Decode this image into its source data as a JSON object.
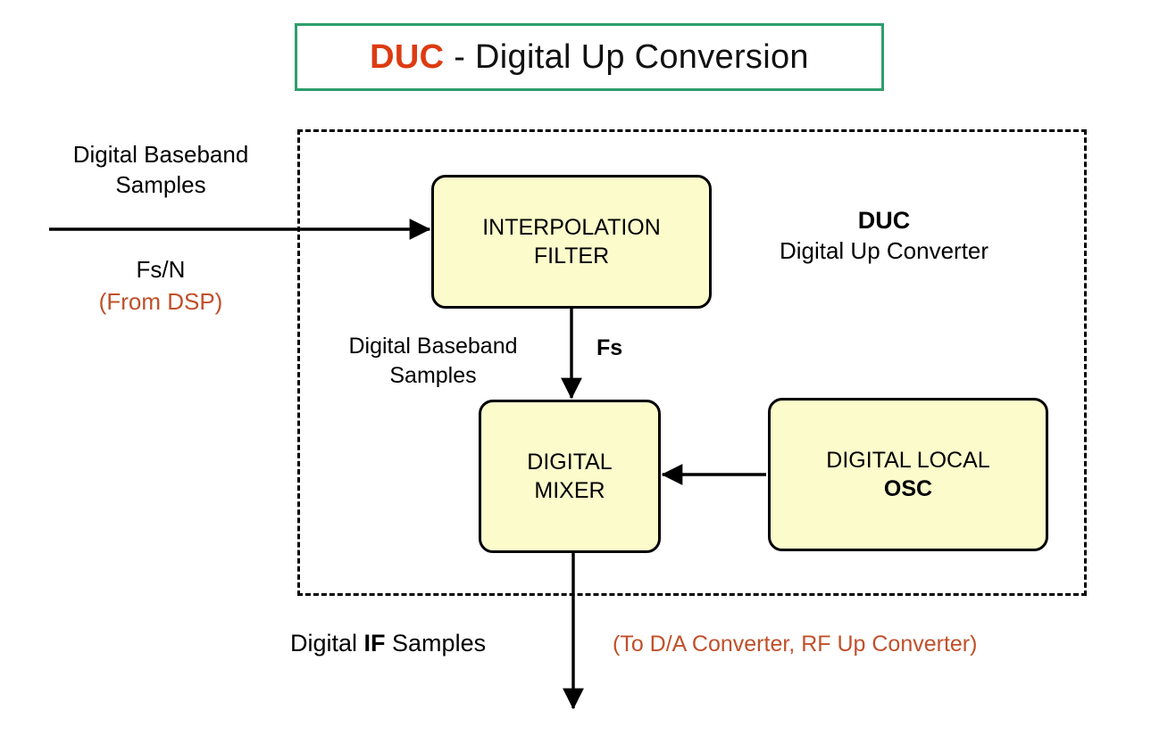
{
  "title": {
    "accent": "DUC",
    "separator": " - ",
    "rest": "Digital Up Conversion"
  },
  "boundary": {
    "name": "DUC enclosure",
    "style": "dashed"
  },
  "blocks": [
    {
      "id": "interpolation-filter",
      "line1": "INTERPOLATION",
      "line2": "FILTER",
      "line2_bold": false
    },
    {
      "id": "digital-mixer",
      "line1": "DIGITAL",
      "line2": "MIXER",
      "line2_bold": false
    },
    {
      "id": "digital-local-osc",
      "line1": "DIGITAL LOCAL",
      "line2": "OSC",
      "line2_bold": true
    }
  ],
  "labels": {
    "input_top_line1": "Digital Baseband",
    "input_top_line2": "Samples",
    "input_rate": "Fs/N",
    "input_source": "(From DSP)",
    "duc_abbrev": "DUC",
    "duc_full": "Digital Up Converter",
    "mid_line1": "Digital Baseband",
    "mid_line2": "Samples",
    "mid_rate": "Fs",
    "output_prefix": "Digital ",
    "output_bold": "IF",
    "output_suffix": " Samples",
    "output_destination": "(To D/A Converter, RF Up Converter)"
  },
  "colors": {
    "title_accent": "#dd3b11",
    "title_border": "#2e9e6b",
    "note_accent": "#c0502a",
    "block_fill": "#fbfbcb",
    "block_stroke": "#000000",
    "wire": "#000000"
  },
  "wires": [
    {
      "name": "baseband-input-arrow",
      "from": "left edge",
      "to": "interpolation-filter",
      "direction": "right"
    },
    {
      "name": "interp-to-mixer-arrow",
      "from": "interpolation-filter",
      "to": "digital-mixer",
      "direction": "down",
      "rate": "Fs"
    },
    {
      "name": "osc-to-mixer-arrow",
      "from": "digital-local-osc",
      "to": "digital-mixer",
      "direction": "left"
    },
    {
      "name": "mixer-output-arrow",
      "from": "digital-mixer",
      "to": "output",
      "direction": "down"
    }
  ]
}
